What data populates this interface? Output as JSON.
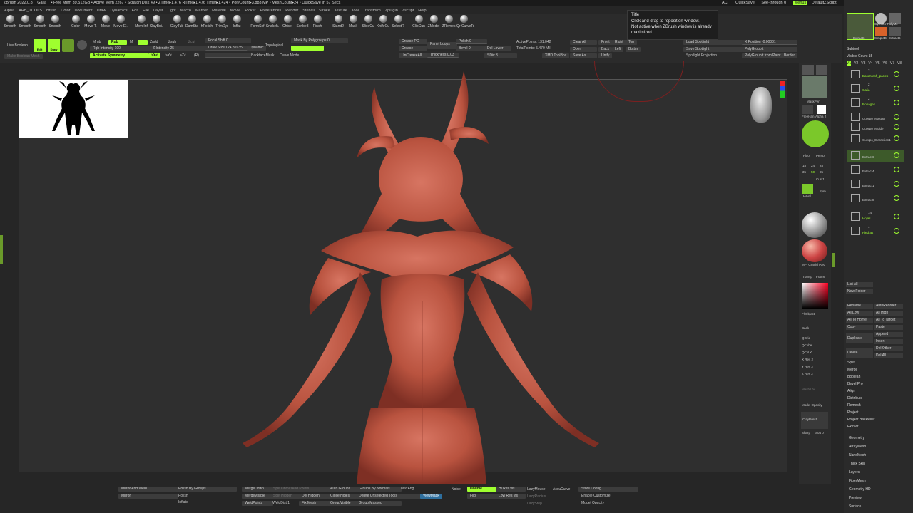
{
  "titlebar": {
    "app": "ZBrush 2022.0.8",
    "doc": "Galia",
    "stats": "• Free Mem 39.512GB • Active Mem 2267 • Scratch Disk 49 • ZTime▸1.476 RTime▸1.476 Timer▸1.424 • PolyCount▸3.883 MP • MeshCount▸24 • QuickSave In 57 Secs",
    "right": [
      "AC",
      "QuickSave",
      "See-through 0",
      "Menus",
      "DefaultZScript"
    ]
  },
  "menus": [
    "Alpha",
    "ARB_TOOLS",
    "Brush",
    "Color",
    "Document",
    "Draw",
    "Dynamics",
    "Edit",
    "File",
    "Layer",
    "Light",
    "Macro",
    "Marker",
    "Material",
    "Movie",
    "Picker",
    "Preferences",
    "Render",
    "Stencil",
    "Stroke",
    "Texture",
    "Tool",
    "Transform",
    "Zplugin",
    "Zscript",
    "Help"
  ],
  "brushes1": [
    "Smooth",
    "Smooth",
    "Smooth",
    "Smooth",
    "Color",
    "Move T.",
    "Move",
    "Move El.",
    "MoveInf",
    "ClayBui.",
    "ClayTub",
    "DamSta",
    "hPolish",
    "TrimDyr",
    "Inflat",
    "FormSof",
    "Snakeh.",
    "Chisel",
    "Scribe3",
    "Pinch",
    "Stand2",
    "Mask",
    "SliceCu",
    "KnifeCu",
    "SelectR",
    "ClipCun",
    "ZModel",
    "ZRemes",
    "Qr CurveTs"
  ],
  "toolbar": {
    "live_boolean": "Live Boolean",
    "make_boolean": "Make Boolean Mesh",
    "edit": "Edit",
    "draw": "Draw",
    "mrgb": "Mrgb",
    "rgb": "Rgb",
    "m": "M",
    "zadd": "Zadd",
    "zsub": "Zsub",
    "zcut": "Zcut",
    "rgb_intensity": "Rgb Intensity 100",
    "z_intensity": "Z Intensity 25",
    "activate_symmetry": "Activate Symmetry",
    "sym": [
      ">X<",
      ">Y<",
      ">Z<",
      "(R)"
    ],
    "focal_shift": "Focal Shift 0",
    "draw_size": "Draw Size 124.85935",
    "dynamic": "Dynamic",
    "topological": "Topological",
    "backface_mask": "BackfaceMask",
    "curve_mode": "Curve Mode",
    "mask_by_polygroups": "Mask By Polygroups 0",
    "crease_pg": "Crease PG",
    "crease": "Crease",
    "uncrease_all": "UnCreaseAll",
    "panel_loops": "Panel Loops",
    "thickness": "Thickness 0.03",
    "polish": "Polish 0",
    "bevel": "Bevel 0",
    "sdiv": "SDiv 3",
    "del_lower": "Del Lower",
    "active_points": "ActivePoints: 131,042",
    "total_points": "TotalPoints: 5.470 Mil",
    "xmd_toolbox": "XMD ToolBox",
    "clear_all": "Clear All",
    "open": "Open",
    "save_as": "Save As",
    "front": "Front",
    "right": "Right",
    "top": "Top",
    "back": "Back",
    "left": "Left",
    "bottom": "Bottm",
    "unify": "Unify",
    "load_spotlight": "Load Spotlight",
    "save_spotlight": "Save Spotlight",
    "spotlight_projection": "Spotlight Projection",
    "x_position": "X Position -0.00001",
    "polygroupit": "PolyGroupIt",
    "polygroupit_paint": "PolyGroupIt from Paint",
    "border": "Border"
  },
  "tooltip": {
    "title": "Title",
    "line1": "Click and drag to reposition window.",
    "line2": "Not active when ZBrush window is already",
    "line3": "maximized."
  },
  "side": {
    "persp": "Persp",
    "floor": "Floor",
    "local": "Local",
    "nums": [
      "18",
      "24",
      "28",
      "35",
      "50",
      "85"
    ],
    "cust1": "Cust1",
    "xpose": "Xpose",
    "qgrid": "QGrid",
    "qcube": "QCube",
    "qcyl": "QCyl Y",
    "xres": "X Res 2",
    "yres": "Y Res 2",
    "zres": "Z Res 2",
    "mesh_uv": "Mesh UV",
    "model_opacity": "Model Opacity",
    "claypolish": "ClayPolish",
    "sharp": "Sharp",
    "soft": "Soft 0",
    "flat_object": "FltObject",
    "transp": "Transp",
    "fill": "Fill",
    "alpha2": "Alpha 2",
    "maskpen": "MaskPen",
    "freehand": "FreeHan",
    "mp_grayish": "MP_GrayishRed",
    "back": "Back",
    "lsym": "L.Sym",
    "frame": "Frame"
  },
  "subtool": {
    "header": "Subtool",
    "visible_count": "Visible Count 15",
    "levels": [
      "V1",
      "V2",
      "V3",
      "V4",
      "V5",
      "V6",
      "V7",
      "V8"
    ],
    "items": [
      {
        "name": "BaseMesh_partes",
        "count": "2"
      },
      {
        "name": "Galia",
        "count": "2"
      },
      {
        "name": "Ropages",
        "count": "2"
      },
      {
        "name": "Cuerpo_Mastan",
        "count": ""
      },
      {
        "name": "Cuerpo_Molde",
        "count": ""
      },
      {
        "name": "Cuerpo_Extraction1",
        "count": ""
      },
      {
        "name": "Extract6",
        "count": ""
      },
      {
        "name": "Extract4",
        "count": ""
      },
      {
        "name": "Extract1",
        "count": ""
      },
      {
        "name": "Extract8",
        "count": ""
      },
      {
        "name": "Hojas",
        "count": "14"
      },
      {
        "name": "Piedras",
        "count": "4"
      }
    ],
    "top_thumbs": [
      "Extract6",
      "SimpleB",
      "Extract6"
    ],
    "top_labels": [
      "Cylinder PolyMe"
    ],
    "buttons": [
      "List All",
      "New Folder",
      "Rename",
      "AutoReorder",
      "All Low",
      "All High",
      "All To Home",
      "All To Target",
      "Copy",
      "Paste",
      "Duplicate",
      "Append",
      "Insert",
      "Delete",
      "Del Other",
      "Del All"
    ],
    "sections": [
      "Split",
      "Merge",
      "Boolean",
      "Bevel Pro",
      "Align",
      "Distribute",
      "Remesh",
      "Project",
      "Project BasRelief",
      "Extract"
    ],
    "palettes": [
      "Geometry",
      "ArrayMesh",
      "NanoMesh",
      "Thick Skin",
      "Layers",
      "FiberMesh",
      "Geometry HD",
      "Preview",
      "Surface"
    ]
  },
  "bottom": {
    "mirror_and_weld": "Mirror And Weld",
    "mirror": "Mirror",
    "polish_by_groups": "Polish By Groups",
    "polish": "Polish",
    "inflate": "Inflate",
    "merge_down": "MergeDown",
    "merge_visible": "MergeVisible",
    "weld_points": "WeldPoints",
    "weld_dist": "WeldDist 1",
    "split_unmasked": "Split Unmasked Points",
    "split_hidden": "Split Hidden",
    "del_hidden": "Del Hidden",
    "fix_mesh": "Fix Mesh",
    "auto_groups": "Auto Groups",
    "close_holes": "Close Holes",
    "group_visible": "GroupVisible",
    "groups_by_normals": "Groups By Normals",
    "delete_unselected": "Delete Unselected Tools",
    "group_masked": "Group Masked",
    "maxangle": "MaxAng",
    "view_mask": "ViewMask",
    "noise": "Noise",
    "double": "Double",
    "flip": "Flip",
    "hi_res_vis": "Hi Res vis",
    "low_res_vis": "Low Res vis",
    "lazymouse": "LazyMouse",
    "lazy_radius": "LazyRadius",
    "lazy_step": "LazyStep",
    "accucurve": "AccuCurve",
    "store_config": "Store Config",
    "enable_customize": "Enable Customize",
    "model_opacity": "Model Opacity"
  },
  "colors": {
    "accent": "#9fff2f",
    "figure": "#c45e4c",
    "bg": "#262626"
  }
}
